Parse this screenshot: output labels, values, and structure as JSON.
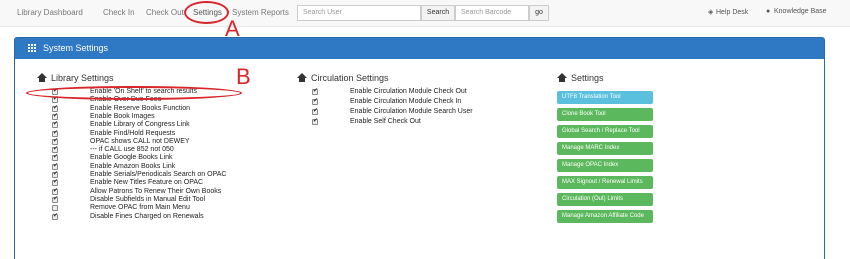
{
  "nav": {
    "links": [
      "Library Dashboard",
      "Check In",
      "Check Out",
      "Settings",
      "System Reports"
    ],
    "active": "Settings",
    "search_user_placeholder": "Search User",
    "search_button": "Search",
    "search_barcode_placeholder": "Search Barcode",
    "go_button": "go",
    "help_desk": "Help Desk",
    "knowledge_base": "Knowledge Base"
  },
  "annotations": {
    "a": "A",
    "b": "B"
  },
  "panel": {
    "title": "System Settings"
  },
  "library_settings": {
    "title": "Library Settings",
    "items": [
      {
        "label": "Enable 'On Shelf' to search results",
        "checked": true
      },
      {
        "label": "Enable Over Due Fees",
        "checked": true
      },
      {
        "label": "Enable Reserve Books Function",
        "checked": true
      },
      {
        "label": "Enable Book Images",
        "checked": true
      },
      {
        "label": "Enable Library of Congress Link",
        "checked": true
      },
      {
        "label": "Enable Find/Hold Requests",
        "checked": true
      },
      {
        "label": "OPAC shows CALL not DEWEY",
        "checked": true
      },
      {
        "label": "--- if CALL use 852 not 050",
        "checked": true
      },
      {
        "label": "Enable Google Books Link",
        "checked": true
      },
      {
        "label": "Enable Amazon Books Link",
        "checked": true
      },
      {
        "label": "Enable Serials/Periodicals Search on OPAC",
        "checked": true
      },
      {
        "label": "Enable New Titles Feature on OPAC",
        "checked": true
      },
      {
        "label": "Allow Patrons To Renew Their Own Books",
        "checked": true
      },
      {
        "label": "Disable Subfields in Manual Edit Tool",
        "checked": true
      },
      {
        "label": "Remove OPAC from Main Menu",
        "checked": false
      },
      {
        "label": "Disable Fines Charged on Renewals",
        "checked": true
      }
    ]
  },
  "circulation_settings": {
    "title": "Circulation Settings",
    "items": [
      {
        "label": "Enable Circulation Module Check Out",
        "checked": true
      },
      {
        "label": "Enable Circulation Module Check In",
        "checked": true
      },
      {
        "label": "Enable Circulation Module Search User",
        "checked": true
      },
      {
        "label": "Enable Self Check Out",
        "checked": true
      }
    ]
  },
  "settings_tools": {
    "title": "Settings",
    "buttons": [
      {
        "label": "UTF8 Translation Tool",
        "style": "info"
      },
      {
        "label": "Clone Book Tool",
        "style": "success"
      },
      {
        "label": "Global Search / Replace Tool",
        "style": "success"
      },
      {
        "label": "Manage MARC Index",
        "style": "success"
      },
      {
        "label": "Manage OPAC Index",
        "style": "success"
      },
      {
        "label": "MAX Signout / Renewal Limits",
        "style": "success"
      },
      {
        "label": "Circulation (Out) Limits",
        "style": "success"
      },
      {
        "label": "Manage Amazon Affiliate Code",
        "style": "success"
      }
    ]
  },
  "colors": {
    "panel_heading": "#2f78c4",
    "annotation": "#d9262a",
    "button_info": "#5bc0de",
    "button_success": "#5cb85c"
  }
}
